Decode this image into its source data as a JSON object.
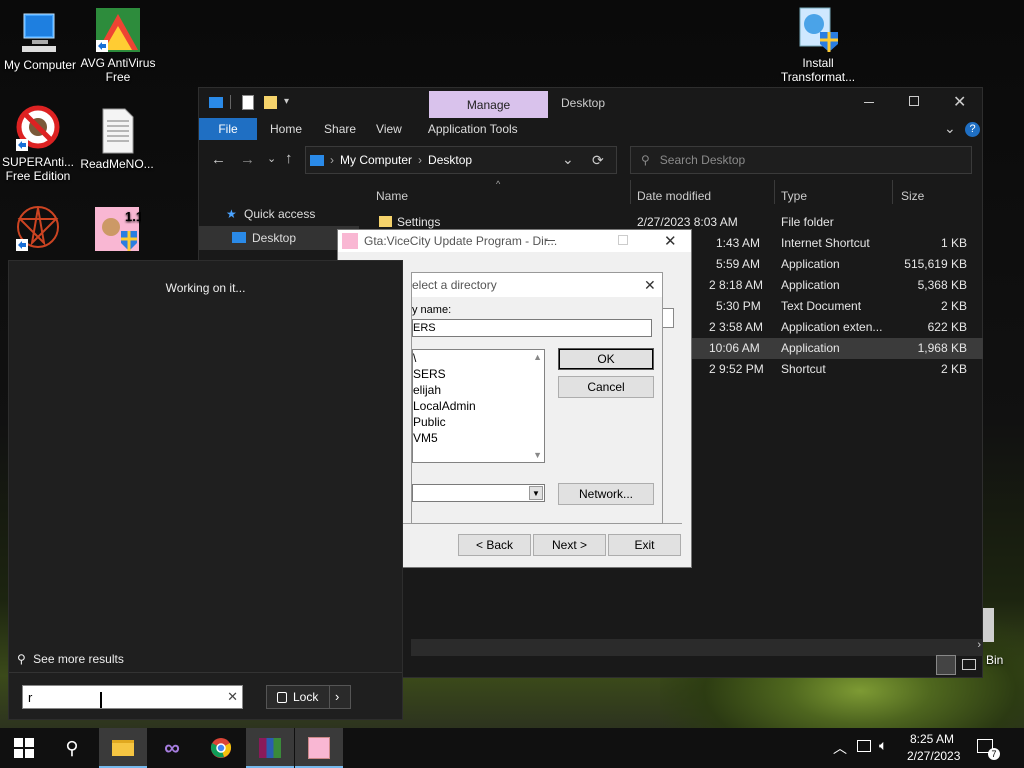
{
  "desktop": {
    "icons": [
      {
        "label": "My Computer"
      },
      {
        "label": "AVG AntiVirus Free"
      },
      {
        "label": "SUPERAnti... Free Edition"
      },
      {
        "label": "ReadMeNO..."
      },
      {
        "label": "Install Transformat..."
      },
      {
        "label": "Bin"
      }
    ]
  },
  "explorer": {
    "manage_tab": "Manage",
    "title": "Desktop",
    "ribbon": [
      "File",
      "Home",
      "Share",
      "View",
      "Application Tools"
    ],
    "breadcrumb": [
      "My Computer",
      "Desktop"
    ],
    "search_placeholder": "Search Desktop",
    "nav": [
      "Quick access",
      "Desktop"
    ],
    "columns": {
      "name": "Name",
      "date": "Date modified",
      "type": "Type",
      "size": "Size"
    },
    "rows": [
      {
        "name": "Settings",
        "date": "2/27/2023 8:03 AM",
        "type": "File folder",
        "size": ""
      },
      {
        "name": "",
        "date": "1:43 AM",
        "type": "Internet Shortcut",
        "size": "1 KB"
      },
      {
        "name": "",
        "date": "5:59 AM",
        "type": "Application",
        "size": "515,619 KB"
      },
      {
        "name": "",
        "date": "2 8:18 AM",
        "type": "Application",
        "size": "5,368 KB"
      },
      {
        "name": "",
        "date": "5:30 PM",
        "type": "Text Document",
        "size": "2 KB"
      },
      {
        "name": "",
        "date": "2 3:58 AM",
        "type": "Application exten...",
        "size": "622 KB"
      },
      {
        "name": "",
        "date": "10:06 AM",
        "type": "Application",
        "size": "1,968 KB"
      },
      {
        "name": "",
        "date": "2 9:52 PM",
        "type": "Shortcut",
        "size": "2 KB"
      }
    ]
  },
  "installer": {
    "title": "Gta:ViceCity Update Program - Dir...",
    "back": "< Back",
    "next": "Next >",
    "exit": "Exit",
    "dir_dialog": {
      "title": "elect a directory",
      "label": "y name:",
      "value": "ERS",
      "list": [
        "\\",
        "SERS",
        "elijah",
        "LocalAdmin",
        "Public",
        "VM5"
      ],
      "ok": "OK",
      "cancel": "Cancel",
      "network": "Network..."
    }
  },
  "search_panel": {
    "status": "Working on it...",
    "see_more": "See more results",
    "query": "r",
    "lock": "Lock"
  },
  "taskbar": {
    "time": "8:25 AM",
    "date": "2/27/2023",
    "notif_count": "7"
  },
  "colors": {
    "accent": "#1f6fc3",
    "manage": "#d9c2ec"
  }
}
